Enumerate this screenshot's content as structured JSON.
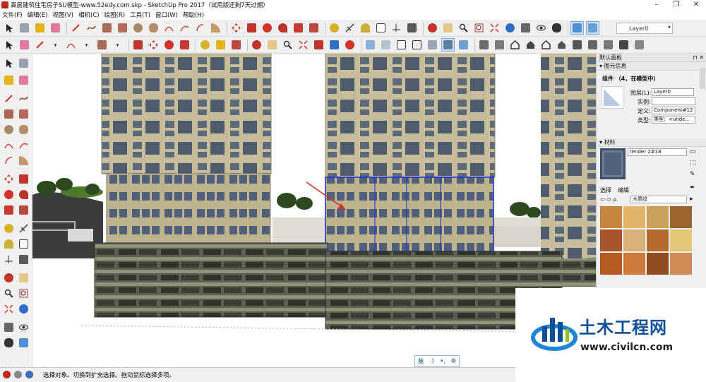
{
  "window": {
    "title": "高层建筑住宅房子SU模型-www.52edy.com.skp - SketchUp Pro 2017（试用版还剩7天过期）",
    "buttons": {
      "minimize": "–",
      "restore": "❐",
      "close": "✕"
    }
  },
  "menu": [
    "文件(F)",
    "编辑(E)",
    "视图(V)",
    "相机(C)",
    "绘图(R)",
    "工具(T)",
    "窗口(W)",
    "帮助(H)"
  ],
  "toolbar": {
    "layer_value": "Layer0",
    "colors": {
      "red": "#d4322a",
      "green": "#3d9a3a",
      "blue": "#2f6fc7",
      "yellow": "#e4b51b",
      "gray": "#8a8a8a",
      "pink": "#e07aa0",
      "brown": "#8b5a2b"
    }
  },
  "panel": {
    "title": "默认面板",
    "entity_info": {
      "header": "图元信息",
      "type_label": "组件 （4，在模型中）",
      "layer_label": "图层(L):",
      "layer_value": "Layer0",
      "instance_label": "实例:",
      "instance_value": "",
      "definition_label": "定义:",
      "definition_value": "Component#12",
      "type_field_label": "类型:",
      "type_field_value": "类型：<unde..."
    },
    "materials": {
      "header": "材料",
      "material_name": "render 2#18",
      "tabs": [
        "选择",
        "编辑"
      ],
      "library": "木质纹",
      "swatches": [
        "#c7853f",
        "#e2b56a",
        "#caa05a",
        "#9c6530",
        "#a7542a",
        "#d7b07a",
        "#b56b2f",
        "#e3c87a",
        "#b65a22",
        "#cf7a3c",
        "#8e4b20",
        "#d28a55"
      ]
    }
  },
  "status": {
    "text": "选择对象。切换到扩充选择。拖动鼠标选择多项。"
  },
  "ime": {
    "lang": "英",
    "moon": "☽",
    "dot": "•,",
    "gear": "⚙"
  },
  "watermark": {
    "name": "土木工程网",
    "url": "www.civilcn.com"
  }
}
